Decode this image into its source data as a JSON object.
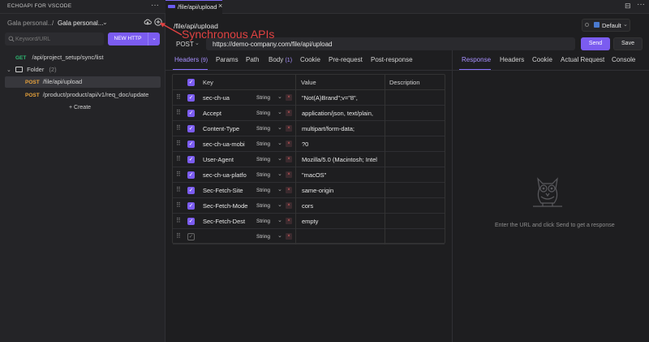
{
  "titlebar": {
    "app_title": "ECHOAPI FOR VSCODE",
    "more": "···",
    "tab_label": "/file/api/upload",
    "tab_close": "×",
    "split": "⊟",
    "more2": "···"
  },
  "sidebar": {
    "workspace_left": "Gala personal...",
    "separator": "/",
    "workspace_right": "Gala personal...",
    "chevron": "⌄",
    "search_placeholder": "Keyword/URL",
    "new_http_label": "NEW HTTP",
    "new_http_drop": "⌄",
    "tree": {
      "get_method": "GET",
      "get_path": "/api/project_setup/sync/list",
      "folder_arrow": "⌄",
      "folder_name": "Folder",
      "folder_count": "(2)",
      "upload_method": "POST",
      "upload_path": "/file/api/upload",
      "reqdoc_method": "POST",
      "reqdoc_path": "/product/product/api/v1/req_doc/update"
    },
    "create_label": "+ Create",
    "annotation": "Synchronous APIs"
  },
  "request": {
    "title": "/file/api/upload",
    "environment": "Default",
    "env_chevron": "⌄",
    "method": "POST",
    "method_chevron": "⌄",
    "url": "https://demo-company.com/file/api/upload",
    "send_label": "Send",
    "save_label": "Save",
    "tabs": [
      {
        "label": "Headers",
        "count": "(9)"
      },
      {
        "label": "Params"
      },
      {
        "label": "Path"
      },
      {
        "label": "Body",
        "count": "(1)"
      },
      {
        "label": "Cookie"
      },
      {
        "label": "Pre-request"
      },
      {
        "label": "Post-response"
      }
    ],
    "table_headers": {
      "key": "Key",
      "value": "Value",
      "description": "Description"
    },
    "rows": [
      {
        "key": "sec-ch-ua",
        "type": "String",
        "value": "\"Not(A)Brand\";v=\"8\","
      },
      {
        "key": "Accept",
        "type": "String",
        "value": "application/json, text/plain,"
      },
      {
        "key": "Content-Type",
        "type": "String",
        "value": "multipart/form-data;"
      },
      {
        "key": "sec-ch-ua-mobi",
        "type": "String",
        "value": "?0"
      },
      {
        "key": "User-Agent",
        "type": "String",
        "value": "Mozilla/5.0 (Macintosh; Intel"
      },
      {
        "key": "sec-ch-ua-platfo",
        "type": "String",
        "value": "\"macOS\""
      },
      {
        "key": "Sec-Fetch-Site",
        "type": "String",
        "value": "same-origin"
      },
      {
        "key": "Sec-Fetch-Mode",
        "type": "String",
        "value": "cors"
      },
      {
        "key": "Sec-Fetch-Dest",
        "type": "String",
        "value": "empty"
      },
      {
        "key": "",
        "type": "String",
        "value": ""
      }
    ],
    "type_chevron": "⌄",
    "delete_glyph": "×",
    "drag_glyph": "⠿",
    "check_glyph": "✓"
  },
  "response": {
    "tabs": [
      "Response",
      "Headers",
      "Cookie",
      "Actual Request",
      "Console"
    ],
    "empty_message": "Enter the URL and click Send to get a response"
  },
  "colors": {
    "accent": "#7b5cf0",
    "get": "#2eb872",
    "post": "#e8a33c",
    "annotation": "#e04242"
  },
  "icons": {
    "cloud": "cloud-upload-icon",
    "add": "add-icon",
    "search": "search-icon",
    "owl": "owl-illustration-icon"
  }
}
